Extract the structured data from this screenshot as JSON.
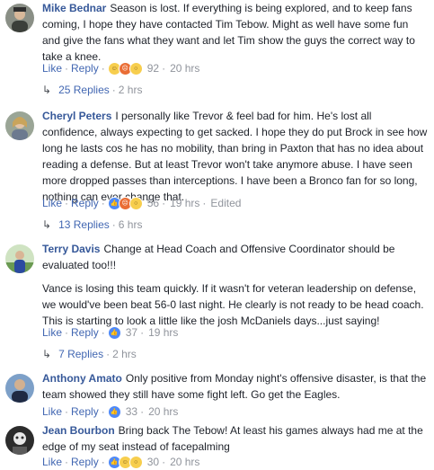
{
  "comments": [
    {
      "author": "Mike Bednar",
      "text": "Season is lost. If everything is being explored, and to keep fans coming, I hope they have contacted Tim Tebow. Might as well have some fun and give the fans what they want and let Tim show the guys the correct way to take a knee.",
      "like": "Like",
      "reply": "Reply",
      "reactions": [
        "haha",
        "angry",
        "wow"
      ],
      "count": "92",
      "time": "20 hrs",
      "replies_label": "25 Replies",
      "replies_time": "2 hrs"
    },
    {
      "author": "Cheryl Peters",
      "text": "I personally like Trevor & feel bad for him. He's lost all confidence, always expecting to get sacked. I hope they do put Brock in see how long he lasts cos he has no mobility, than bring in Paxton that has no idea about reading a defense. But at least Trevor won't take anymore abuse. I have seen more dropped passes than interceptions. I have been a Bronco fan for so long, nothing can ever change that.",
      "like": "Like",
      "reply": "Reply",
      "reactions": [
        "like",
        "angry",
        "wow"
      ],
      "count": "56",
      "time": "19 hrs",
      "edited": "Edited",
      "replies_label": "13 Replies",
      "replies_time": "6 hrs"
    },
    {
      "author": "Terry Davis",
      "text": "Change at Head Coach and Offensive Coordinator should be evaluated too!!!",
      "text2": "Vance is losing this team quickly. If it wasn't for veteran leadership on defense, we would've been beat 56-0 last night. He clearly is not ready to be head coach. This is starting to look a little like the josh McDaniels days...just saying!",
      "like": "Like",
      "reply": "Reply",
      "reactions": [
        "like"
      ],
      "count": "37",
      "time": "19 hrs",
      "replies_label": "7 Replies",
      "replies_time": "2 hrs"
    },
    {
      "author": "Anthony Amato",
      "text": "Only positive from Monday night's offensive disaster, is that the team showed they still have some fight left. Go get the Eagles.",
      "like": "Like",
      "reply": "Reply",
      "reactions": [
        "like"
      ],
      "count": "33",
      "time": "20 hrs"
    },
    {
      "author": "Jean Bourbon",
      "text": "Bring back The Tebow! At least his games always had me at the edge of my seat instead of facepalming",
      "like": "Like",
      "reply": "Reply",
      "reactions": [
        "like",
        "haha",
        "wow"
      ],
      "count": "30",
      "time": "20 hrs"
    }
  ],
  "colors": {
    "author": "#365899",
    "link": "#4267b2",
    "meta": "#90949c",
    "text": "#1d2129"
  }
}
